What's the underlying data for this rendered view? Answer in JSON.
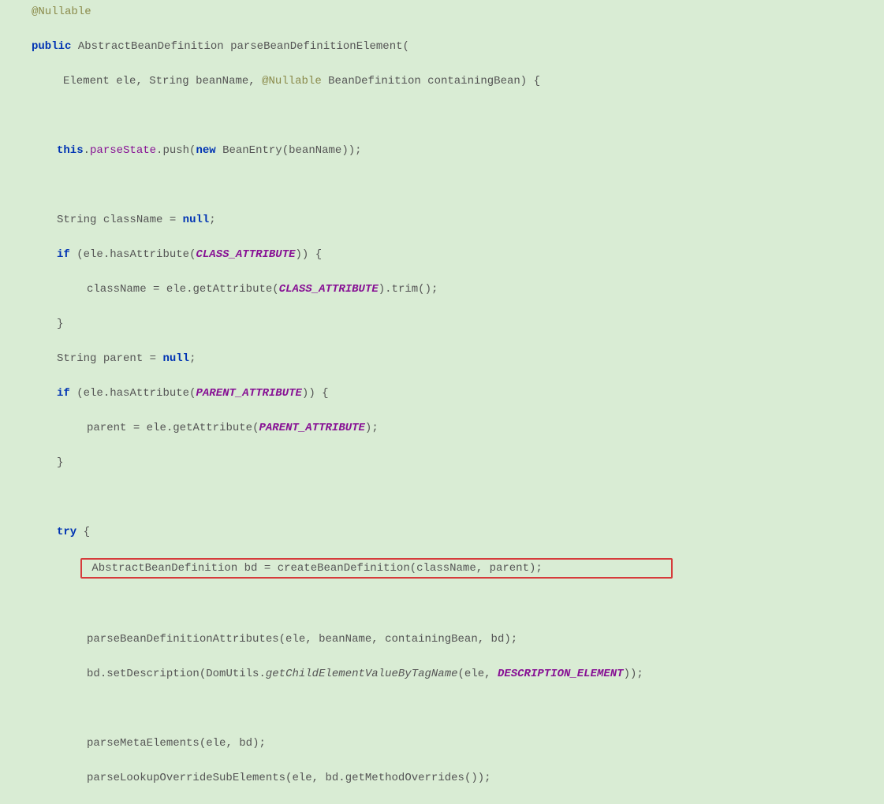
{
  "code": {
    "annotation_nullable": "@Nullable",
    "kw_public": "public",
    "type_abd": "AbstractBeanDefinition",
    "method_parseBDE": "parseBeanDefinitionElement",
    "punc_lparen": "(",
    "punc_rparen": ")",
    "punc_lbrace": "{",
    "punc_rbrace": "}",
    "punc_semi": ";",
    "punc_comma": ",",
    "punc_dot": ".",
    "type_element": "Element",
    "param_ele": "ele",
    "type_string": "String",
    "param_beanName": "beanName",
    "type_beandef": "BeanDefinition",
    "param_containingBean": "containingBean",
    "kw_this": "this",
    "field_parseState": "parseState",
    "m_push": "push",
    "kw_new": "new",
    "type_BeanEntry": "BeanEntry",
    "var_className": "className",
    "eq": " = ",
    "kw_null": "null",
    "kw_if": "if",
    "m_hasAttribute": "hasAttribute",
    "const_CLASS_ATTRIBUTE": "CLASS_ATTRIBUTE",
    "m_getAttribute": "getAttribute",
    "m_trim": "trim",
    "var_parent": "parent",
    "const_PARENT_ATTRIBUTE": "PARENT_ATTRIBUTE",
    "kw_try": "try",
    "var_bd": "bd",
    "m_createBeanDefinition": "createBeanDefinition",
    "m_parseBeanDefinitionAttributes": "parseBeanDefinitionAttributes",
    "m_setDescription": "setDescription",
    "type_DomUtils": "DomUtils",
    "m_getChildElementValueByTagName": "getChildElementValueByTagName",
    "const_DESCRIPTION_ELEMENT": "DESCRIPTION_ELEMENT",
    "m_parseMetaElements": "parseMetaElements",
    "m_parseLookupOverrideSubElements": "parseLookupOverrideSubElements",
    "m_getMethodOverrides": "getMethodOverrides"
  }
}
